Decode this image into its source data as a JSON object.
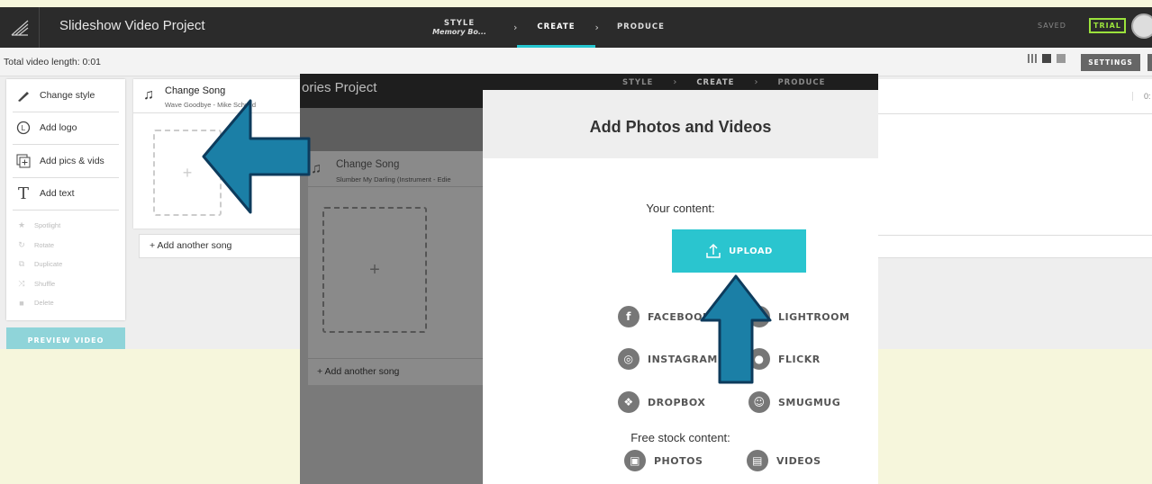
{
  "topbar": {
    "project_title": "Slideshow Video Project",
    "steps": {
      "style_label": "STYLE",
      "style_value": "Memory Bo...",
      "create_label": "CREATE",
      "produce_label": "PRODUCE"
    },
    "saved_label": "SAVED",
    "trial_label": "TRIAL"
  },
  "subbar": {
    "total_length": "Total video length: 0:01",
    "settings_label": "SETTINGS"
  },
  "sidebar": {
    "items": [
      {
        "label": "Change style",
        "icon": "brush-icon"
      },
      {
        "label": "Add logo",
        "icon": "logo-icon"
      },
      {
        "label": "Add pics & vids",
        "icon": "add-media-icon"
      },
      {
        "label": "Add text",
        "icon": "text-icon"
      }
    ],
    "disabled_items": [
      {
        "label": "Spotlight",
        "icon": "star-icon"
      },
      {
        "label": "Rotate",
        "icon": "rotate-icon"
      },
      {
        "label": "Duplicate",
        "icon": "duplicate-icon"
      },
      {
        "label": "Shuffle",
        "icon": "shuffle-icon"
      },
      {
        "label": "Delete",
        "icon": "trash-icon"
      }
    ],
    "preview_label": "PREVIEW VIDEO"
  },
  "song": {
    "title": "Change Song",
    "artist": "Wave Goodbye - Mike Schmid",
    "add_another": "+ Add another song"
  },
  "right_time": "0:",
  "overlay": {
    "project_title": "ories Project",
    "steps": {
      "style_label": "STYLE",
      "create_label": "CREATE",
      "produce_label": "PRODUCE"
    },
    "song": {
      "title": "Change Song",
      "artist": "Slumber My Darling (Instrument - Edie",
      "add_another": "+ Add another song"
    },
    "dialog": {
      "title": "Add Photos and Videos",
      "your_content": "Your content:",
      "upload_label": "UPLOAD",
      "sources": [
        {
          "label": "FACEBOOK",
          "icon": "facebook-icon"
        },
        {
          "label": "LIGHTROOM",
          "icon": "lightroom-icon"
        },
        {
          "label": "INSTAGRAM",
          "icon": "instagram-icon"
        },
        {
          "label": "FLICKR",
          "icon": "flickr-icon"
        },
        {
          "label": "DROPBOX",
          "icon": "dropbox-icon"
        },
        {
          "label": "SMUGMUG",
          "icon": "smugmug-icon"
        }
      ],
      "free_stock": "Free stock content:",
      "stock": [
        {
          "label": "PHOTOS",
          "icon": "photos-icon"
        },
        {
          "label": "VIDEOS",
          "icon": "videos-icon"
        }
      ]
    }
  },
  "colors": {
    "accent": "#2ac5cf",
    "arrow_fill": "#1b7fa6",
    "arrow_stroke": "#0d3b5c",
    "background": "#f6f6dc"
  }
}
